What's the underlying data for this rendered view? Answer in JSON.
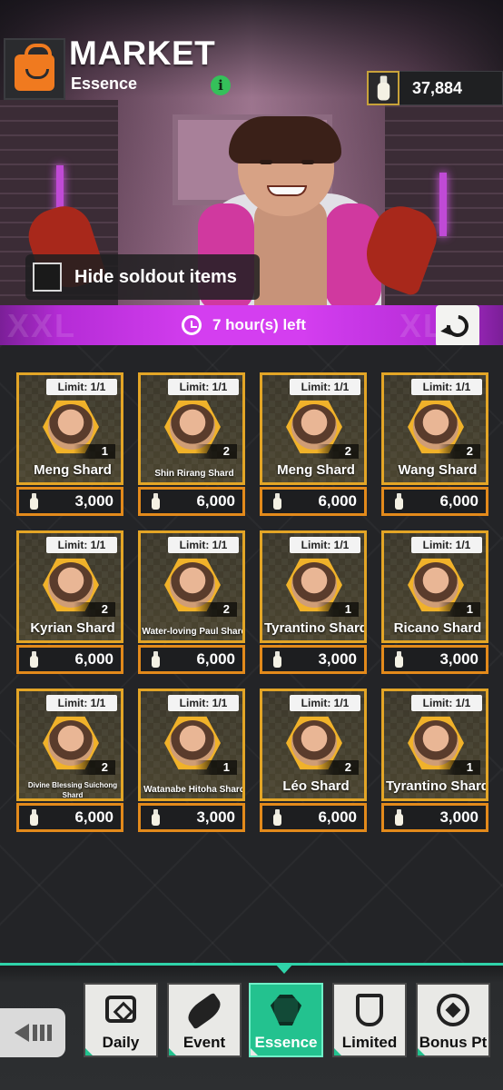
{
  "header": {
    "title": "MARKET",
    "subtitle": "Essence",
    "info_glyph": "i",
    "currency_amount": "37,884"
  },
  "filter": {
    "hide_soldout_label": "Hide soldout items",
    "checked": false
  },
  "timer": {
    "label": "7 hour(s) left",
    "banner_text_left": "XXL",
    "banner_text_right": "XL"
  },
  "items": [
    {
      "limit": "Limit: 1/1",
      "qty": "1",
      "name": "Meng Shard",
      "price": "3,000"
    },
    {
      "limit": "Limit: 1/1",
      "qty": "2",
      "name": "Shin Rirang Shard",
      "price": "6,000"
    },
    {
      "limit": "Limit: 1/1",
      "qty": "2",
      "name": "Meng Shard",
      "price": "6,000"
    },
    {
      "limit": "Limit: 1/1",
      "qty": "2",
      "name": "Wang Shard",
      "price": "6,000"
    },
    {
      "limit": "Limit: 1/1",
      "qty": "2",
      "name": "Kyrian Shard",
      "price": "6,000"
    },
    {
      "limit": "Limit: 1/1",
      "qty": "2",
      "name": "Water-loving Paul Shard",
      "price": "6,000"
    },
    {
      "limit": "Limit: 1/1",
      "qty": "1",
      "name": "Tyrantino Shard",
      "price": "3,000"
    },
    {
      "limit": "Limit: 1/1",
      "qty": "1",
      "name": "Ricano Shard",
      "price": "3,000"
    },
    {
      "limit": "Limit: 1/1",
      "qty": "2",
      "name": "Divine Blessing Suichong Shard",
      "price": "6,000"
    },
    {
      "limit": "Limit: 1/1",
      "qty": "1",
      "name": "Watanabe Hitoha Shard",
      "price": "3,000"
    },
    {
      "limit": "Limit: 1/1",
      "qty": "2",
      "name": "Léo Shard",
      "price": "6,000"
    },
    {
      "limit": "Limit: 1/1",
      "qty": "1",
      "name": "Tyrantino Shard",
      "price": "3,000"
    }
  ],
  "tabs": [
    {
      "label": "Daily",
      "icon": "chest-icon"
    },
    {
      "label": "Event",
      "icon": "fish-icon"
    },
    {
      "label": "Essence",
      "icon": "gem-icon",
      "active": true
    },
    {
      "label": "Limited",
      "icon": "hourglass-icon"
    },
    {
      "label": "Bonus Pt",
      "icon": "medal-icon"
    }
  ],
  "colors": {
    "accent_green": "#23c28f",
    "card_frame": "#e3a526",
    "timer_bar": "#d43ef0",
    "shop_icon": "#f07a1f"
  }
}
